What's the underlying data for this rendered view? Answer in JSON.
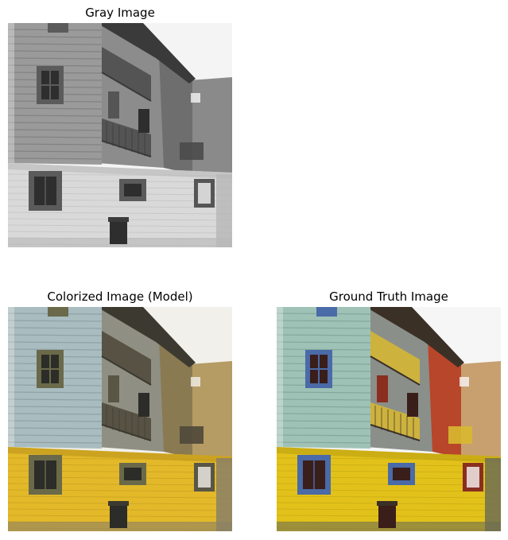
{
  "panels": {
    "gray": {
      "title": "Gray Image",
      "colors": {
        "sky": "#f4f4f4",
        "left_wall": "#9a9a9a",
        "left_wall_dark": "#6f6f6f",
        "mid_wall": "#8c8c8c",
        "right_wall": "#6e6e6e",
        "far_wall": "#8a8a8a",
        "base_wall": "#d9d9d9",
        "base_shadow": "#bdbdbd",
        "window_frame": "#5b5b5b",
        "window_glass": "#2e2e2e",
        "balcony": "#4a4a4a",
        "roof": "#3a3a3a",
        "ground": "#b8b8b8",
        "door": "#555555"
      }
    },
    "colorized": {
      "title": "Colorized Image (Model)",
      "colors": {
        "sky": "#f1f0ea",
        "left_wall": "#a9bcc0",
        "left_wall_dark": "#7d8e92",
        "mid_wall": "#8f8f84",
        "right_wall": "#8a7a52",
        "far_wall": "#b59b64",
        "base_wall": "#e3b92a",
        "base_shadow": "#c29a1d",
        "window_frame": "#6a6a4a",
        "window_glass": "#2c2c28",
        "balcony": "#4e4838",
        "roof": "#3c3a30",
        "ground": "#8a8066",
        "door": "#5a5646"
      }
    },
    "truth": {
      "title": "Ground Truth Image",
      "colors": {
        "sky": "#f6f6f6",
        "left_wall": "#9fc2b6",
        "left_wall_dark": "#6f948a",
        "mid_wall": "#8a8f8a",
        "right_wall": "#b8462a",
        "far_wall": "#c8a070",
        "base_wall": "#e2c21a",
        "base_shadow": "#c2a412",
        "window_frame": "#4a6aa8",
        "window_glass": "#3a1e1a",
        "balcony": "#d8b830",
        "roof": "#3a3026",
        "ground": "#6e6e52",
        "door": "#8a2e20"
      }
    }
  }
}
